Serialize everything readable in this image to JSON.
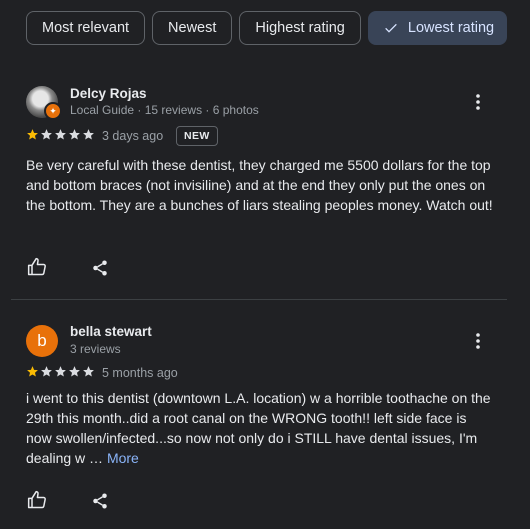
{
  "filters": [
    {
      "label": "Most relevant",
      "selected": false
    },
    {
      "label": "Newest",
      "selected": false
    },
    {
      "label": "Highest rating",
      "selected": false
    },
    {
      "label": "Lowest rating",
      "selected": true
    }
  ],
  "reviews": [
    {
      "name": "Delcy Rojas",
      "meta": "Local Guide · 15 reviews · 6 photos",
      "rating": 1,
      "max_rating": 5,
      "date": "3 days ago",
      "badge": "NEW",
      "text": "Be very careful with these dentist, they charged me 5500 dollars for the top and bottom braces (not invisiline) and at the end they only put the ones on the bottom. They are a bunches of liars stealing peoples money. Watch out!"
    },
    {
      "name": "bella stewart",
      "avatar_letter": "b",
      "meta": "3 reviews",
      "rating": 1,
      "max_rating": 5,
      "date": "5 months ago",
      "text": "i went to this dentist (downtown L.A. location) w a horrible toothache on the 29th this month..did a root canal on the WRONG tooth!! left side face is now swollen/infected...so now not only do i STILL have dental issues, I'm dealing w …",
      "more_label": "More"
    }
  ],
  "colors": {
    "background": "#202124",
    "star_filled": "#fbbc04",
    "star_empty": "#dadce0",
    "link": "#8ab4f8",
    "avatar_orange": "#e8710a"
  }
}
